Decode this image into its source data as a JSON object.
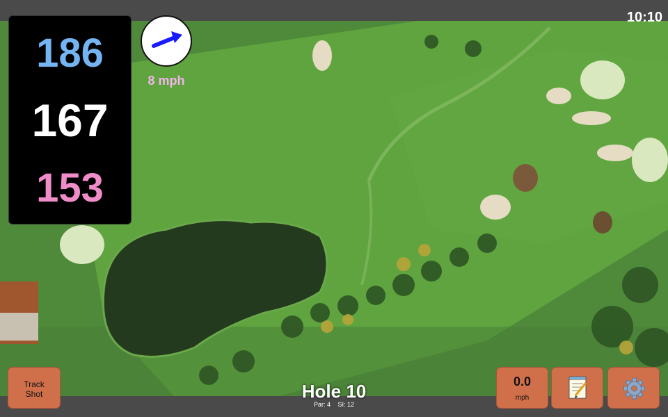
{
  "status": {
    "time": "10:10"
  },
  "distances": {
    "back": "186",
    "middle": "167",
    "front": "153"
  },
  "wind": {
    "speed_label": "8 mph",
    "arrow_icon": "wind-direction-arrow-icon",
    "arrow_color": "#1a1aff"
  },
  "buttons": {
    "track_shot_line1": "Track",
    "track_shot_line2": "Shot",
    "speed_value": "0.0",
    "speed_unit": "mph",
    "notes_icon": "notepad-icon",
    "settings_icon": "gear-icon"
  },
  "hole": {
    "title": "Hole 10",
    "par": "Par: 4",
    "stroke_index": "SI: 12"
  },
  "colors": {
    "back": "#74b4f2",
    "middle": "#ffffff",
    "front": "#f08cc8",
    "button": "#d0704a",
    "wind_text": "#f3b4ee"
  }
}
